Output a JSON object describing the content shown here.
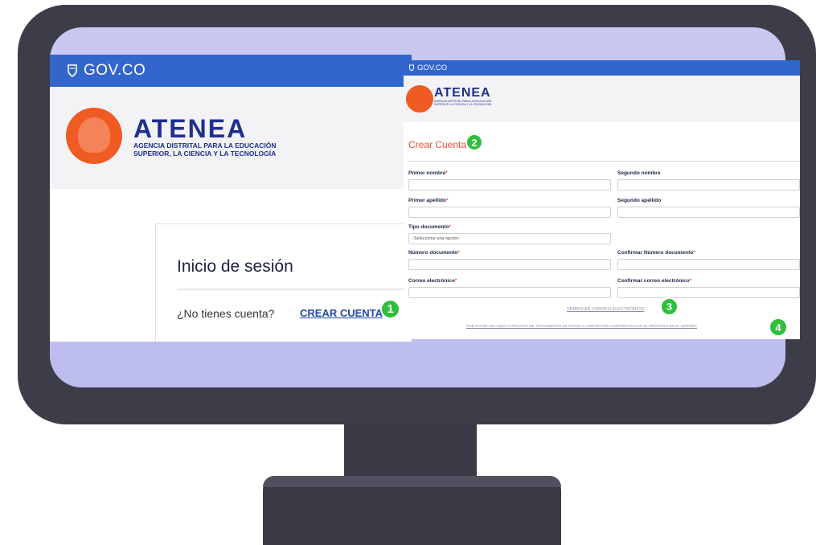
{
  "screen_a": {
    "gov_label": "GOV.CO",
    "brand_name": "ATENEA",
    "brand_sub1": "AGENCIA DISTRITAL PARA LA EDUCACIÓN",
    "brand_sub2": "SUPERIOR, LA CIENCIA Y LA TECNOLOGÍA",
    "login_title": "Inicio de sesión",
    "no_account_text": "¿No tienes cuenta?",
    "create_account_link": "CREAR CUENTA"
  },
  "screen_b": {
    "gov_label": "GOV.CO",
    "brand_name": "ATENEA",
    "brand_sub1": "AGENCIA DISTRITAL PARA LA EDUCACIÓN",
    "brand_sub2": "SUPERIOR, LA CIENCIA Y LA TECNOLOGÍA",
    "form_title": "Crear Cuenta",
    "fields": {
      "first_name": "Primer nombre",
      "second_name": "Segundo nombre",
      "first_surname": "Primer apellido",
      "second_surname": "Segundo apellido",
      "doc_type": "Tipo documento",
      "doc_type_placeholder": "-Seleccione una opción-",
      "doc_number": "Número documento",
      "confirm_doc_number": "Confirmar Número documento",
      "email": "Correo electrónico",
      "confirm_email": "Confirmar correo electrónico"
    },
    "required_mark": "*",
    "verify_email_link": "VERIFICAR CORREO ELECTRÓNICO",
    "policy_link": "POR FAVOR LEA AQUÍ LA POLITICA DE TRATAMIENTO DE DATOS Y ACEPTE PARA CONTINUAR CON EL REGISTRO EN EL SISTEMA"
  },
  "badges": {
    "step1": "1",
    "step2": "2",
    "step3": "3",
    "step4": "4"
  },
  "colors": {
    "gov_bar": "#3366cc",
    "brand_orange": "#f05a23",
    "brand_navy": "#1e2f8f",
    "badge_green": "#2fbf3b",
    "monitor_frame": "#3d3d4a",
    "screen_bg": "#c8c8f3"
  }
}
